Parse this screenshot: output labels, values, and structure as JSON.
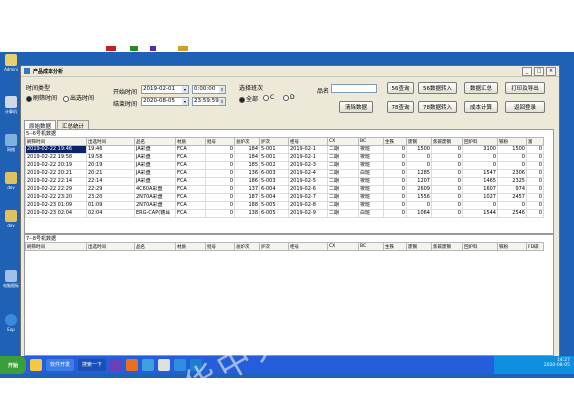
{
  "window": {
    "title": "产品成本分析"
  },
  "filters": {
    "time_type_label": "时间类型",
    "radio_scan_time": "刷筛时间",
    "radio_out_time": "出选时间",
    "start_time_label": "开始时间",
    "end_time_label": "结束时间",
    "start_date": "2019-02-01",
    "end_date": "2020-08-05",
    "start_clock": "0:00:00",
    "end_clock": "23:59:59",
    "shift_label": "选择班次",
    "shift_all": "全部",
    "shift_c": "C",
    "shift_d": "D",
    "product_label": "品名",
    "product_value": ""
  },
  "buttons": {
    "q56": "56查询",
    "q56_import": "56数据转入",
    "summary": "数据汇总",
    "print_export": "打印及导出",
    "clear": "清除数据",
    "q78": "78查询",
    "q78_import": "78数据转入",
    "cost_calc": "成本计算",
    "back_login": "返回登录"
  },
  "tabs": {
    "raw": "原始数据",
    "stats": "汇总统计"
  },
  "section1": {
    "title": "5--6号机数据",
    "columns": [
      "刷筛时间",
      "出选时间",
      "品名",
      "材质",
      "批号",
      "总炉次",
      "炉次",
      "柜号",
      "CX",
      "BC",
      "生铁",
      "废钢",
      "焦碳废钢",
      "回炉料",
      "铁粉",
      "富"
    ],
    "rows": [
      [
        "2019-02-22 19:46",
        "19:46",
        "JA彩盘",
        "FCA",
        "0",
        "184",
        "5-001",
        "2019-02-1",
        "二期",
        "夜班",
        "0",
        "1500",
        "0",
        "3100",
        "1500",
        "0"
      ],
      [
        "2019-02-22 19:58",
        "19:58",
        "JA彩盘",
        "FCA",
        "0",
        "184",
        "5-001",
        "2019-02-1",
        "二期",
        "夜班",
        "0",
        "0",
        "0",
        "0",
        "0",
        "0"
      ],
      [
        "2019-02-22 20:19",
        "20:19",
        "JA彩盘",
        "FCA",
        "0",
        "185",
        "5-002",
        "2019-02-3",
        "二期",
        "夜班",
        "0",
        "0",
        "0",
        "0",
        "0",
        "0"
      ],
      [
        "2019-02-22 20:21",
        "20:21",
        "JA彩盘",
        "FCA",
        "0",
        "136",
        "6-003",
        "2019-02-4",
        "二期",
        "白班",
        "0",
        "1285",
        "0",
        "1547",
        "2306",
        "0"
      ],
      [
        "2019-02-22 22:14",
        "22:14",
        "JA彩盘",
        "FCA",
        "0",
        "186",
        "5-003",
        "2019-02-5",
        "二期",
        "夜班",
        "0",
        "1207",
        "0",
        "1465",
        "2325",
        "0"
      ],
      [
        "2019-02-22 22:29",
        "22:29",
        "4C60A彩盘",
        "FCA",
        "0",
        "137",
        "6-004",
        "2019-02-6",
        "二期",
        "夜班",
        "0",
        "2609",
        "0",
        "1607",
        "974",
        "0"
      ],
      [
        "2019-02-22 23:20",
        "23:20",
        "2N70A彩盘",
        "FCA",
        "0",
        "187",
        "5-004",
        "2019-02-7",
        "二期",
        "夜班",
        "0",
        "1556",
        "0",
        "1027",
        "2457",
        "0"
      ],
      [
        "2019-02-23 01:09",
        "01:09",
        "2N70A彩盘",
        "FCA",
        "0",
        "188",
        "5-005",
        "2019-02-8",
        "二期",
        "夜班",
        "0",
        "0",
        "0",
        "0",
        "0",
        "0"
      ],
      [
        "2019-02-23 02:04",
        "02:04",
        "ERG-CAP(铸耳",
        "FCA",
        "0",
        "138",
        "6-005",
        "2019-02-9",
        "二期",
        "白班",
        "0",
        "1064",
        "0",
        "1544",
        "2546",
        "0"
      ]
    ]
  },
  "section2": {
    "title": "7--8号机数据",
    "columns": [
      "刷筛时间",
      "出选时间",
      "品名",
      "材质",
      "批号",
      "总炉次",
      "炉次",
      "柜号",
      "CX",
      "BC",
      "生铁",
      "废钢",
      "焦碳废钢",
      "回炉料",
      "铁粉",
      "FD碳"
    ]
  },
  "taskbar": {
    "start": "开始",
    "task_label": "软件开发",
    "search_label": "搜索一下",
    "clock": "14:27",
    "date": "2020-08-05"
  },
  "desktop_icons": [
    "Admini",
    "计算机",
    "Ne...",
    "网络",
    "dev",
    "dev",
    "电脑图标",
    "Exp"
  ],
  "watermark": "华中天地环保"
}
